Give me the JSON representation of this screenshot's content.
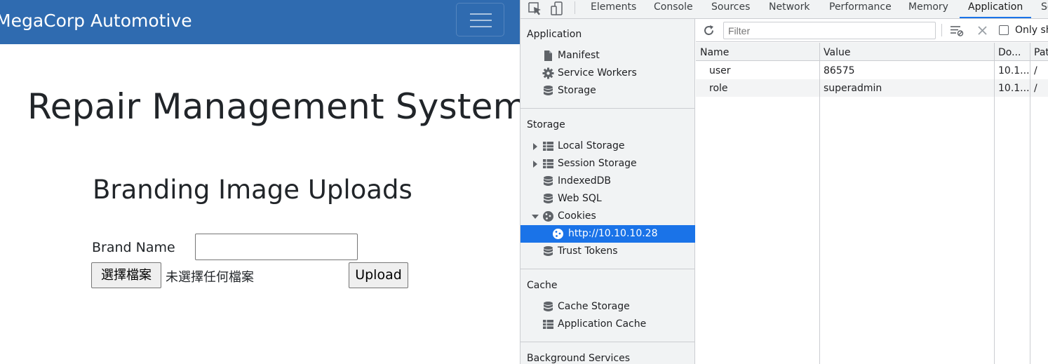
{
  "webpage": {
    "brand": "MegaCorp Automotive",
    "page_title": "Repair Management System",
    "section_title": "Branding Image Uploads",
    "brand_label": "Brand Name",
    "brand_input_value": "",
    "file_button_label": "選擇檔案",
    "file_status": "未選擇任何檔案",
    "upload_label": "Upload",
    "colors": {
      "navbar": "#2f6bb0",
      "text": "#212529"
    }
  },
  "devtools": {
    "tabs": [
      "Elements",
      "Console",
      "Sources",
      "Network",
      "Performance",
      "Memory",
      "Application",
      "Se"
    ],
    "active_tab": "Application",
    "sidebar": {
      "application_heading": "Application",
      "application_items": [
        {
          "label": "Manifest",
          "icon": "file-icon"
        },
        {
          "label": "Service Workers",
          "icon": "gear-icon"
        },
        {
          "label": "Storage",
          "icon": "database-icon"
        }
      ],
      "storage_heading": "Storage",
      "storage_items": [
        {
          "label": "Local Storage",
          "icon": "grid-icon"
        },
        {
          "label": "Session Storage",
          "icon": "grid-icon"
        },
        {
          "label": "IndexedDB",
          "icon": "database-icon"
        },
        {
          "label": "Web SQL",
          "icon": "database-icon"
        },
        {
          "label": "Cookies",
          "icon": "cookie-icon"
        },
        {
          "label": "http://10.10.10.28",
          "icon": "cookie-icon"
        },
        {
          "label": "Trust Tokens",
          "icon": "database-icon"
        }
      ],
      "cache_heading": "Cache",
      "cache_items": [
        {
          "label": "Cache Storage",
          "icon": "database-icon"
        },
        {
          "label": "Application Cache",
          "icon": "grid-icon"
        }
      ],
      "background_heading": "Background Services"
    },
    "filter_placeholder": "Filter",
    "only_show_label": "Only sh",
    "columns": [
      "Name",
      "Value",
      "Do...",
      "Pat"
    ],
    "cookies": [
      {
        "name": "user",
        "value": "86575",
        "domain": "10.1...",
        "path": "/"
      },
      {
        "name": "role",
        "value": "superadmin",
        "domain": "10.1...",
        "path": "/"
      }
    ],
    "colors": {
      "accent": "#1a73e8",
      "panel_bg": "#f1f3f4",
      "border": "#cbcdd1"
    }
  }
}
